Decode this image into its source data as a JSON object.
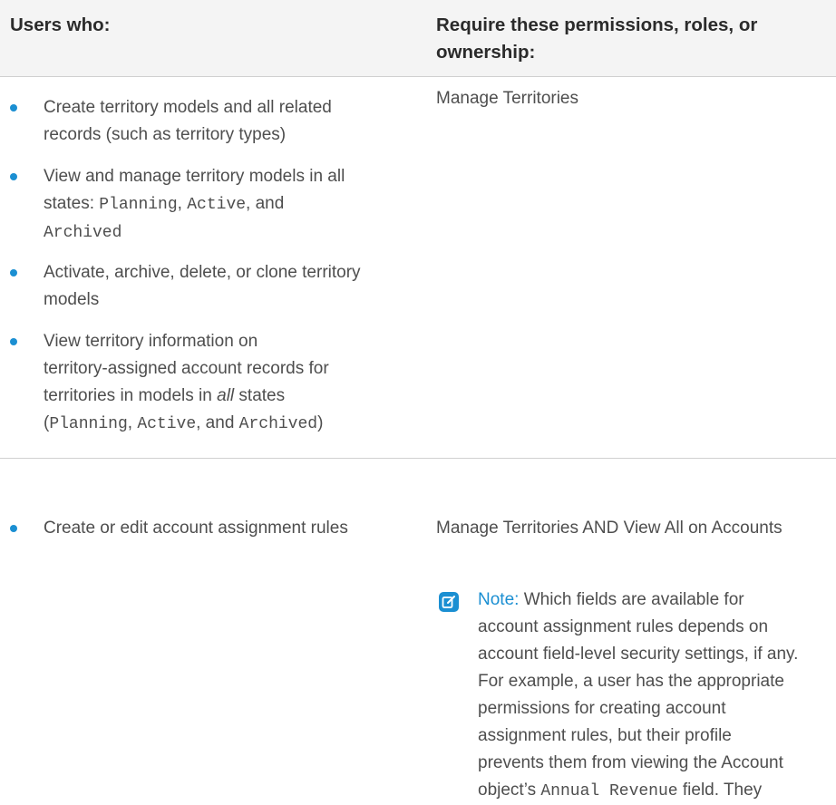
{
  "header": {
    "col1": "Users who:",
    "col2_line1": "Require these permissions, roles, or",
    "col2_line2": "ownership:"
  },
  "row1": {
    "bullets": [
      {
        "lines": [
          "Create territory models and all related",
          "records (such as territory types)"
        ]
      },
      {
        "line1": "View and manage territory models in all",
        "line2_prefix": "states: ",
        "code_planning": "Planning",
        "sep1": ", ",
        "code_active": "Active",
        "sep2": ", and",
        "code_archived": "Archived"
      },
      {
        "lines": [
          "Activate, archive, delete, or clone territory",
          "models"
        ]
      },
      {
        "line1": "View territory information on",
        "line2": "territory-assigned account records for",
        "line3_pre": "territories in models in ",
        "line3_em": "all",
        "line3_post": " states",
        "line4_open": "(",
        "code_planning": "Planning",
        "sep1": ", ",
        "code_active": "Active",
        "sep2": ", and ",
        "code_archived": "Archived",
        "line4_close": ")"
      }
    ],
    "permission": "Manage Territories"
  },
  "row2": {
    "bullet": "Create or edit account assignment rules",
    "permission": "Manage Territories AND View All on Accounts",
    "note_label": "Note:",
    "note_line1": " Which fields are available for",
    "note_lines": [
      "account assignment rules depends on",
      "account field-level security settings, if any.",
      "For example, a user has the appropriate",
      "permissions for creating account",
      "assignment rules, but their profile",
      "prevents them from viewing the Account"
    ],
    "note_last_pre": "object’s ",
    "note_last_code": "Annual Revenue",
    "note_last_post": " field. They"
  },
  "colors": {
    "accent": "#1b8fd2",
    "header_bg": "#f4f4f4"
  },
  "icons": {
    "bullet": "bullet-dot",
    "note": "note-edit-icon"
  }
}
